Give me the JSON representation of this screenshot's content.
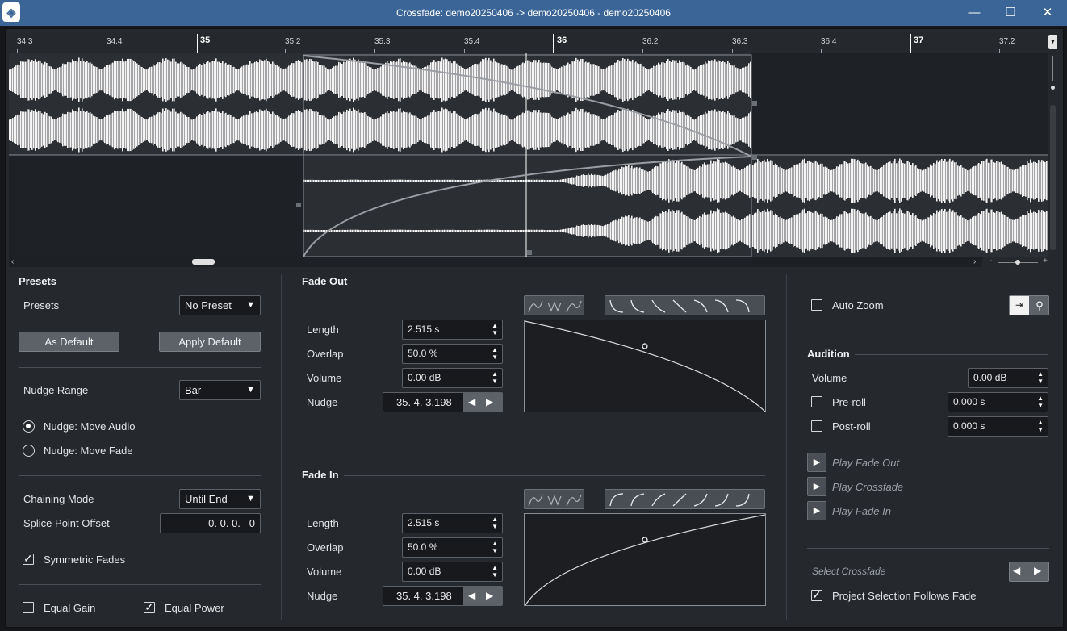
{
  "window": {
    "title": "Crossfade: demo20250406 -> demo20250406 - demo20250406",
    "min": "—",
    "max": "☐",
    "close": "✕"
  },
  "ruler": {
    "labels": [
      "34.3",
      "34.4",
      "35",
      "35.2",
      "35.3",
      "35.4",
      "36",
      "36.2",
      "36.3",
      "36.4",
      "37",
      "37.2"
    ]
  },
  "left": {
    "presets_section": "Presets",
    "presets_label": "Presets",
    "presets_value": "No Preset",
    "as_default": "As Default",
    "apply_default": "Apply Default",
    "nudge_range_label": "Nudge Range",
    "nudge_range_value": "Bar",
    "nudge_move_audio": "Nudge: Move Audio",
    "nudge_move_fade": "Nudge: Move Fade",
    "chaining_label": "Chaining Mode",
    "chaining_value": "Until End",
    "splice_label": "Splice Point Offset",
    "splice_value": "0. 0. 0.   0",
    "symmetric_fades": "Symmetric Fades",
    "equal_gain": "Equal Gain",
    "equal_power": "Equal Power"
  },
  "fade_out": {
    "section": "Fade Out",
    "length_label": "Length",
    "length_value": "2.515 s",
    "overlap_label": "Overlap",
    "overlap_value": "50.0 %",
    "volume_label": "Volume",
    "volume_value": "0.00 dB",
    "nudge_label": "Nudge",
    "nudge_value": "35. 4. 3.198"
  },
  "fade_in": {
    "section": "Fade In",
    "length_label": "Length",
    "length_value": "2.515 s",
    "overlap_label": "Overlap",
    "overlap_value": "50.0 %",
    "volume_label": "Volume",
    "volume_value": "0.00 dB",
    "nudge_label": "Nudge",
    "nudge_value": "35. 4. 3.198"
  },
  "right": {
    "auto_zoom": "Auto Zoom",
    "audition_section": "Audition",
    "volume_label": "Volume",
    "volume_value": "0.00 dB",
    "preroll_label": "Pre-roll",
    "preroll_value": "0.000 s",
    "postroll_label": "Post-roll",
    "postroll_value": "0.000 s",
    "play_fade_out": "Play Fade Out",
    "play_crossfade": "Play Crossfade",
    "play_fade_in": "Play Fade In",
    "select_crossfade": "Select Crossfade",
    "project_selection": "Project Selection Follows Fade"
  }
}
